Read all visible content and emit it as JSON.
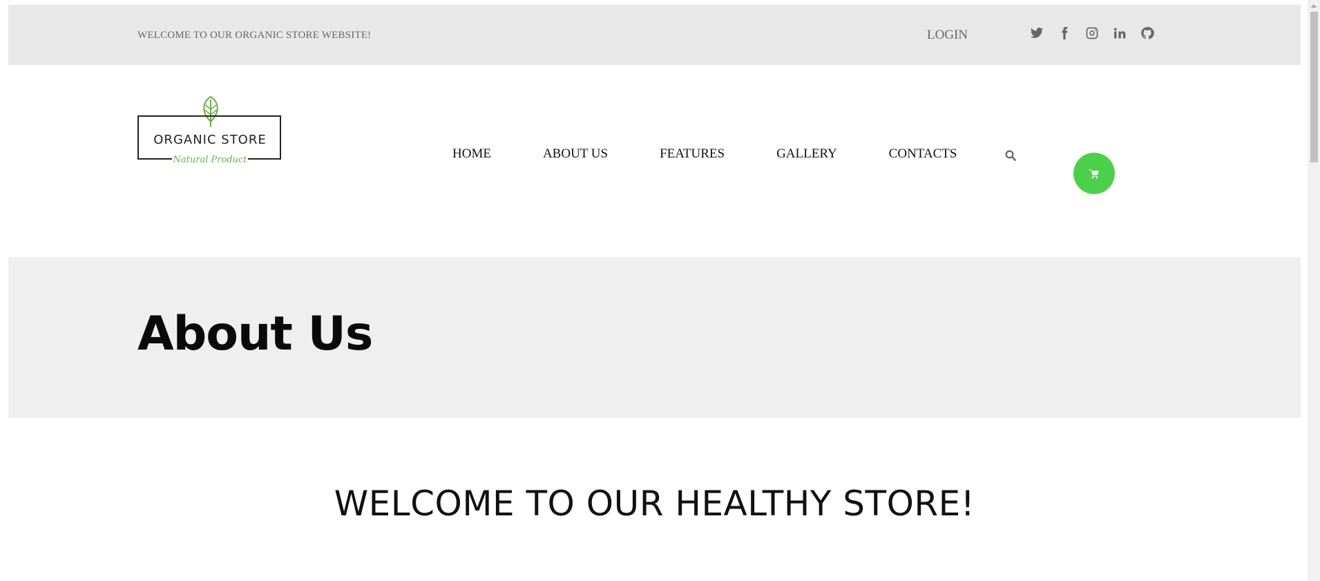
{
  "topbar": {
    "welcome_text": "WELCOME TO OUR ORGANIC STORE WEBSITE!",
    "login_label": "LOGIN",
    "social_icons": [
      "twitter-icon",
      "facebook-icon",
      "instagram-icon",
      "linkedin-icon",
      "github-icon"
    ]
  },
  "logo": {
    "name": "ORGANIC STORE",
    "tagline": "Natural Product"
  },
  "nav": {
    "items": [
      "HOME",
      "ABOUT US",
      "FEATURES",
      "GALLERY",
      "CONTACTS"
    ]
  },
  "icons": {
    "search": "search-icon",
    "cart": "cart-icon"
  },
  "colors": {
    "accent_green": "#4cd04c",
    "leaf_green": "#6ab04c",
    "topbar_bg": "#e8e8e8",
    "hero_bg": "#efefef"
  },
  "hero": {
    "title": "About Us"
  },
  "intro": {
    "heading": "WELCOME TO OUR HEALTHY STORE!"
  }
}
